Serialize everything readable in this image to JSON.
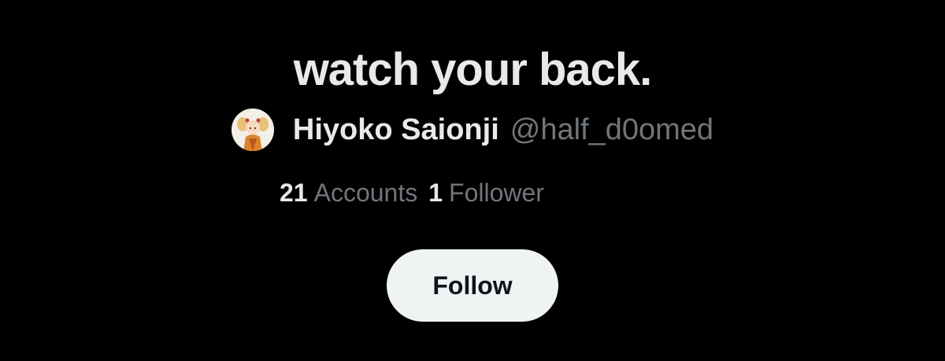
{
  "list": {
    "title": "watch your back."
  },
  "owner": {
    "avatar_icon": "profile-avatar",
    "name": "Hiyoko Saionji",
    "handle": "@half_d0omed"
  },
  "stats": {
    "accounts_count": "21",
    "accounts_label": "Accounts",
    "followers_count": "1",
    "followers_label": "Follower"
  },
  "actions": {
    "follow_label": "Follow"
  },
  "colors": {
    "background": "#000000",
    "primary_text": "#e7e9ea",
    "secondary_text": "#71767b",
    "button_bg": "#eff3f4",
    "button_text": "#0f1419"
  }
}
